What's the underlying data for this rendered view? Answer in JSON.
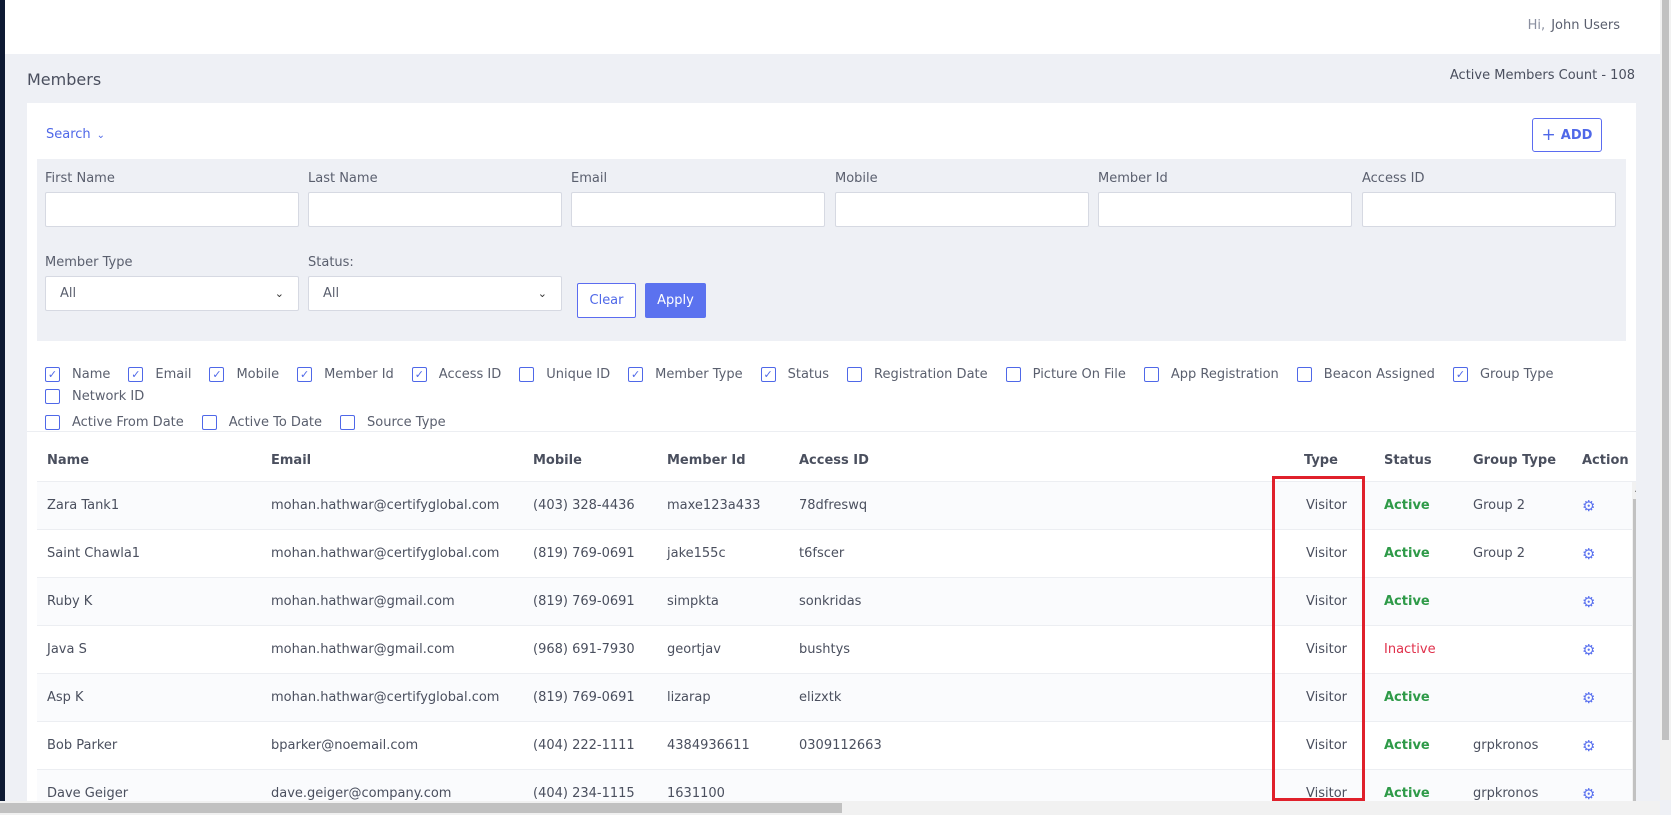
{
  "header": {
    "greeting": "Hi,",
    "user_name": "John Users"
  },
  "page": {
    "title": "Members",
    "active_count_label": "Active Members Count - 108"
  },
  "search": {
    "toggle_label": "Search",
    "add_label": "ADD"
  },
  "filters": {
    "first_name": "First Name",
    "last_name": "Last Name",
    "email": "Email",
    "mobile": "Mobile",
    "member_id": "Member Id",
    "access_id": "Access ID",
    "member_type": {
      "label": "Member Type",
      "value": "All"
    },
    "status": {
      "label": "Status:",
      "value": "All"
    },
    "clear_label": "Clear",
    "apply_label": "Apply"
  },
  "columns_toggle": [
    {
      "label": "Name",
      "checked": true
    },
    {
      "label": "Email",
      "checked": true
    },
    {
      "label": "Mobile",
      "checked": true
    },
    {
      "label": "Member Id",
      "checked": true
    },
    {
      "label": "Access ID",
      "checked": true
    },
    {
      "label": "Unique ID",
      "checked": false
    },
    {
      "label": "Member Type",
      "checked": true
    },
    {
      "label": "Status",
      "checked": true
    },
    {
      "label": "Registration Date",
      "checked": false
    },
    {
      "label": "Picture On File",
      "checked": false
    },
    {
      "label": "App Registration",
      "checked": false
    },
    {
      "label": "Beacon Assigned",
      "checked": false
    },
    {
      "label": "Group Type",
      "checked": true
    },
    {
      "label": "Network ID",
      "checked": false
    },
    {
      "label": "Active From Date",
      "checked": false
    },
    {
      "label": "Active To Date",
      "checked": false
    },
    {
      "label": "Source Type",
      "checked": false
    }
  ],
  "table": {
    "headers": {
      "name": "Name",
      "email": "Email",
      "mobile": "Mobile",
      "member_id": "Member Id",
      "access_id": "Access ID",
      "type": "Type",
      "status": "Status",
      "group": "Group Type",
      "action": "Action"
    },
    "rows": [
      {
        "name": "Zara Tank1",
        "email": "mohan.hathwar@certifyglobal.com",
        "mobile": "(403) 328-4436",
        "member_id": "maxe123a433",
        "access_id": "78dfreswq",
        "type": "Visitor",
        "status": "Active",
        "group": "Group 2"
      },
      {
        "name": "Saint Chawla1",
        "email": "mohan.hathwar@certifyglobal.com",
        "mobile": "(819) 769-0691",
        "member_id": "jake155c",
        "access_id": "t6fscer",
        "type": "Visitor",
        "status": "Active",
        "group": "Group 2"
      },
      {
        "name": "Ruby K",
        "email": "mohan.hathwar@gmail.com",
        "mobile": "(819) 769-0691",
        "member_id": "simpkta",
        "access_id": "sonkridas",
        "type": "Visitor",
        "status": "Active",
        "group": ""
      },
      {
        "name": "Java S",
        "email": "mohan.hathwar@gmail.com",
        "mobile": "(968) 691-7930",
        "member_id": "geortjav",
        "access_id": "bushtys",
        "type": "Visitor",
        "status": "Inactive",
        "group": ""
      },
      {
        "name": "Asp K",
        "email": "mohan.hathwar@certifyglobal.com",
        "mobile": "(819) 769-0691",
        "member_id": "lizarap",
        "access_id": "elizxtk",
        "type": "Visitor",
        "status": "Active",
        "group": ""
      },
      {
        "name": "Bob Parker",
        "email": "bparker@noemail.com",
        "mobile": "(404) 222-1111",
        "member_id": "4384936611",
        "access_id": "0309112663",
        "type": "Visitor",
        "status": "Active",
        "group": "grpkronos"
      },
      {
        "name": "Dave Geiger",
        "email": "dave.geiger@company.com",
        "mobile": "(404) 234-1115",
        "member_id": "1631100",
        "access_id": "",
        "type": "Visitor",
        "status": "Active",
        "group": "grpkronos"
      }
    ]
  },
  "colors": {
    "accent": "#5b72ef",
    "active": "#2e9a48",
    "inactive": "#e0304b",
    "highlight": "#e0202b"
  }
}
